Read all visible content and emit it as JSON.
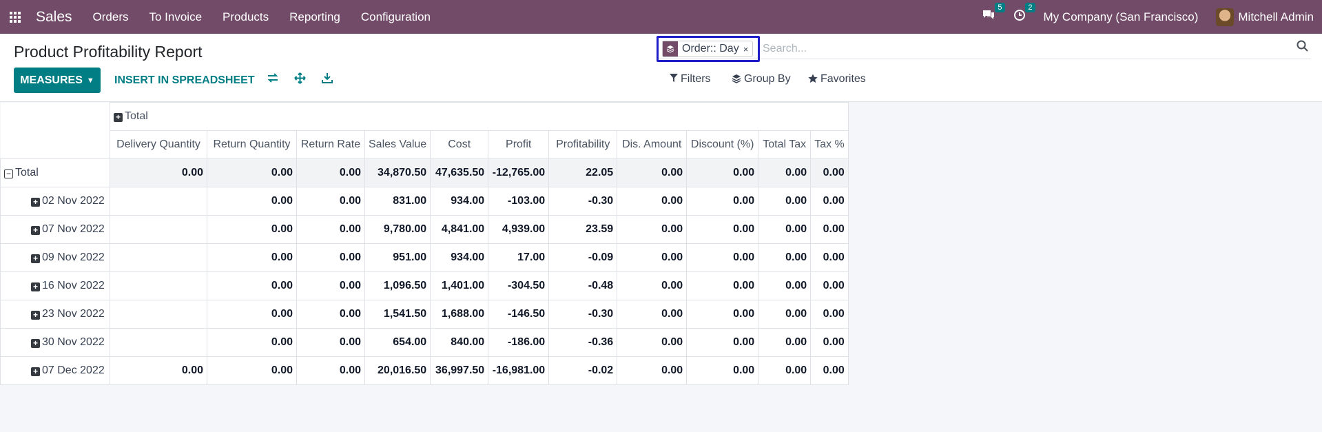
{
  "navbar": {
    "app_name": "Sales",
    "menu": [
      "Orders",
      "To Invoice",
      "Products",
      "Reporting",
      "Configuration"
    ],
    "messages_count": "5",
    "activities_count": "2",
    "company": "My Company (San Francisco)",
    "user": "Mitchell Admin"
  },
  "page": {
    "title": "Product Profitability Report"
  },
  "search": {
    "facet_label": "Order:: Day",
    "facet_remove": "×",
    "placeholder": "Search..."
  },
  "toolbar": {
    "measures_label": "MEASURES",
    "spreadsheet_label": "INSERT IN SPREADSHEET",
    "filters_label": "Filters",
    "group_by_label": "Group By",
    "favorites_label": "Favorites"
  },
  "pivot": {
    "col_header_total": "Total",
    "measures": [
      "Delivery Quantity",
      "Return Quantity",
      "Return Rate",
      "Sales Value",
      "Cost",
      "Profit",
      "Profitability",
      "Dis. Amount",
      "Discount (%)",
      "Total Tax",
      "Tax %"
    ],
    "total_row": {
      "label": "Total",
      "values": [
        "0.00",
        "0.00",
        "0.00",
        "34,870.50",
        "47,635.50",
        "-12,765.00",
        "22.05",
        "0.00",
        "0.00",
        "0.00",
        "0.00"
      ]
    },
    "rows": [
      {
        "label": "02 Nov 2022",
        "values": [
          "",
          "0.00",
          "0.00",
          "831.00",
          "934.00",
          "-103.00",
          "-0.30",
          "0.00",
          "0.00",
          "0.00",
          "0.00"
        ]
      },
      {
        "label": "07 Nov 2022",
        "values": [
          "",
          "0.00",
          "0.00",
          "9,780.00",
          "4,841.00",
          "4,939.00",
          "23.59",
          "0.00",
          "0.00",
          "0.00",
          "0.00"
        ]
      },
      {
        "label": "09 Nov 2022",
        "values": [
          "",
          "0.00",
          "0.00",
          "951.00",
          "934.00",
          "17.00",
          "-0.09",
          "0.00",
          "0.00",
          "0.00",
          "0.00"
        ]
      },
      {
        "label": "16 Nov 2022",
        "values": [
          "",
          "0.00",
          "0.00",
          "1,096.50",
          "1,401.00",
          "-304.50",
          "-0.48",
          "0.00",
          "0.00",
          "0.00",
          "0.00"
        ]
      },
      {
        "label": "23 Nov 2022",
        "values": [
          "",
          "0.00",
          "0.00",
          "1,541.50",
          "1,688.00",
          "-146.50",
          "-0.30",
          "0.00",
          "0.00",
          "0.00",
          "0.00"
        ]
      },
      {
        "label": "30 Nov 2022",
        "values": [
          "",
          "0.00",
          "0.00",
          "654.00",
          "840.00",
          "-186.00",
          "-0.36",
          "0.00",
          "0.00",
          "0.00",
          "0.00"
        ]
      },
      {
        "label": "07 Dec 2022",
        "values": [
          "0.00",
          "0.00",
          "0.00",
          "20,016.50",
          "36,997.50",
          "-16,981.00",
          "-0.02",
          "0.00",
          "0.00",
          "0.00",
          "0.00"
        ]
      }
    ]
  },
  "colors": {
    "navbar": "#714b67",
    "accent": "#017e84",
    "highlight_box": "#1e1ec8"
  }
}
